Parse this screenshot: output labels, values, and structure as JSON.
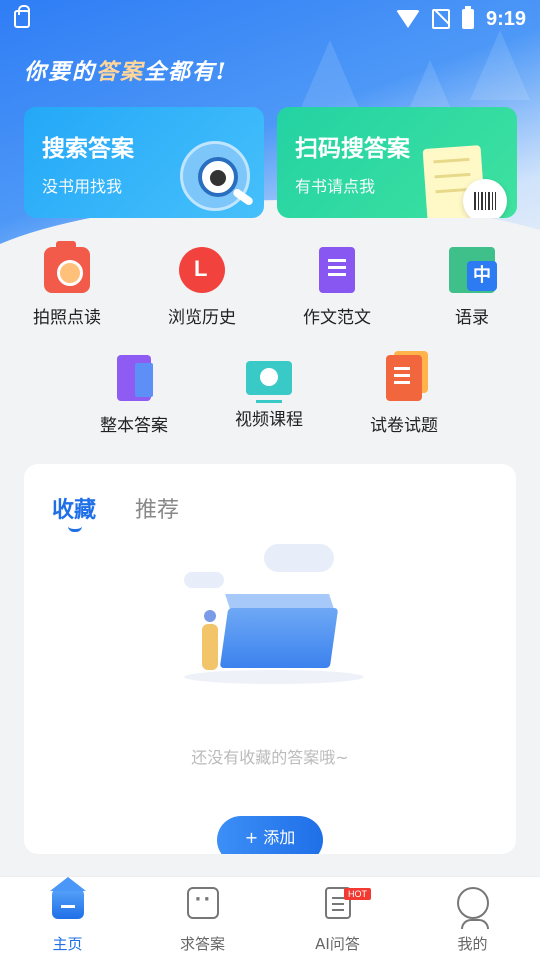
{
  "status_bar": {
    "time": "9:19",
    "icons": [
      "lock-icon",
      "wifi-icon",
      "no-sim-icon",
      "battery-charging-icon"
    ]
  },
  "slogan": {
    "part1": "你要的",
    "highlight": "答案",
    "part2": "全都有!"
  },
  "cards": [
    {
      "title": "搜索答案",
      "subtitle": "没书用找我",
      "icon": "magnifier-mascot-icon"
    },
    {
      "title": "扫码搜答案",
      "subtitle": "有书请点我",
      "icon": "barcode-scan-icon"
    }
  ],
  "features": [
    {
      "label": "拍照点读",
      "icon": "camera-icon"
    },
    {
      "label": "浏览历史",
      "icon": "history-icon"
    },
    {
      "label": "作文范文",
      "icon": "essay-icon"
    },
    {
      "label": "语录",
      "icon": "translate-icon"
    },
    {
      "label": "整本答案",
      "icon": "book-icon"
    },
    {
      "label": "视频课程",
      "icon": "video-icon"
    },
    {
      "label": "试卷试题",
      "icon": "test-paper-icon"
    }
  ],
  "panel": {
    "tabs": [
      {
        "label": "收藏",
        "active": true
      },
      {
        "label": "推荐",
        "active": false
      }
    ],
    "empty_text": "还没有收藏的答案哦~",
    "add_button": "+ 添加"
  },
  "bottom_nav": [
    {
      "label": "主页",
      "icon": "home-icon",
      "active": true
    },
    {
      "label": "求答案",
      "icon": "chat-icon",
      "active": false
    },
    {
      "label": "AI问答",
      "icon": "ai-qa-icon",
      "active": false,
      "badge": "HOT"
    },
    {
      "label": "我的",
      "icon": "profile-icon",
      "active": false
    }
  ],
  "colors": {
    "accent": "#1e6fe8",
    "search_card": "#24a8f7",
    "scan_card": "#23d2a3",
    "hot_badge": "#f23a32"
  }
}
